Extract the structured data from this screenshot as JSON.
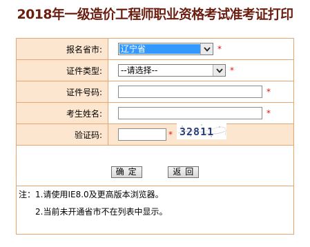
{
  "title": "2018年一级造价工程师职业资格考试准考证打印",
  "form": {
    "province": {
      "label": "报名省市:",
      "value": "辽宁省",
      "required_mark": "*"
    },
    "id_type": {
      "label": "证件类型:",
      "value": "--请选择--",
      "required_mark": "*"
    },
    "id_number": {
      "label": "证件号码:",
      "value": "",
      "required_mark": "*"
    },
    "name": {
      "label": "考生姓名:",
      "value": "",
      "required_mark": "*"
    },
    "captcha": {
      "label": "验证码:",
      "value": "",
      "required_mark": "*",
      "image_text": "32811"
    }
  },
  "buttons": {
    "confirm": "确 定",
    "back": "返 回"
  },
  "notes": {
    "line1": "注：1.请使用IE8.0及更高版本浏览器。",
    "line2": "2.当前未开通省市不在列表中显示。"
  },
  "colors": {
    "title": "#6b1e10",
    "label_bg": "#fde6cf",
    "border": "#e8a46a",
    "required": "#e01010",
    "notes": "#d41414",
    "selected_bg": "#3399ff"
  },
  "icons": {
    "dropdown": "chevron-down-icon"
  }
}
